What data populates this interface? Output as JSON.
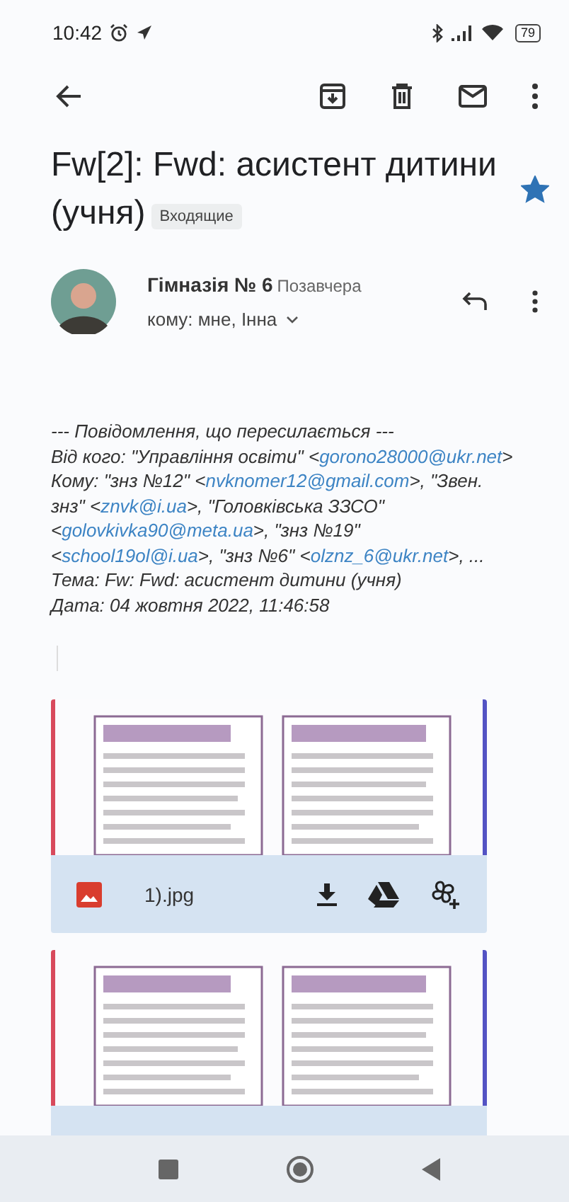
{
  "status_bar": {
    "time": "10:42",
    "battery": "79"
  },
  "subject": {
    "title_lines": [
      "Fw[2]: Fwd: асистент дитини",
      "(учня)"
    ],
    "label": "Входящие",
    "starred": true
  },
  "sender": {
    "name": "Гімназія № 6",
    "date": "Позавчера",
    "recipients": "кому: мне, Інна"
  },
  "forwarded_header": [
    [
      {
        "kind": "text",
        "text": "--- Повідомлення, що пересилається ---"
      }
    ],
    [
      {
        "kind": "text",
        "text": "Від кого: \"Управління освіти\" <"
      },
      {
        "kind": "email",
        "text": "gorono28000@ukr.net"
      },
      {
        "kind": "text",
        "text": ">"
      }
    ],
    [
      {
        "kind": "text",
        "text": "Кому: \"знз №12\" <"
      },
      {
        "kind": "email",
        "text": "nvknomer12@gmail.com"
      },
      {
        "kind": "text",
        "text": ">, \"Звен."
      }
    ],
    [
      {
        "kind": "text",
        "text": "знз\" <"
      },
      {
        "kind": "email",
        "text": "znvk@i.ua"
      },
      {
        "kind": "text",
        "text": ">, \"Головківська ЗЗСО\""
      }
    ],
    [
      {
        "kind": "text",
        "text": "<"
      },
      {
        "kind": "email",
        "text": "golovkivka90@meta.ua"
      },
      {
        "kind": "text",
        "text": ">, \"знз №19\""
      }
    ],
    [
      {
        "kind": "text",
        "text": "<"
      },
      {
        "kind": "email",
        "text": "school19ol@i.ua"
      },
      {
        "kind": "text",
        "text": ">, \"знз №6\" <"
      },
      {
        "kind": "email",
        "text": "olznz_6@ukr.net"
      },
      {
        "kind": "text",
        "text": ">, ..."
      }
    ],
    [
      {
        "kind": "text",
        "text": "Тема: Fw: Fwd: асистент дитини (учня)"
      }
    ],
    [
      {
        "kind": "text",
        "text": "Дата: 04 жовтня 2022, 11:46:58"
      }
    ]
  ],
  "attachments": [
    {
      "kind": "picture",
      "name": "1).jpg"
    },
    {
      "kind": "picture"
    }
  ]
}
